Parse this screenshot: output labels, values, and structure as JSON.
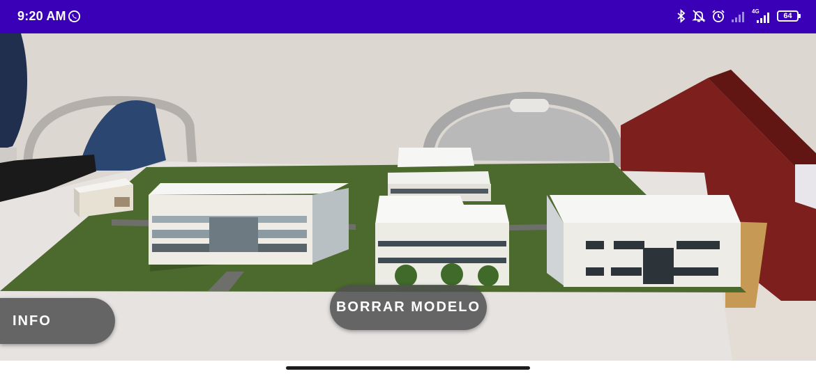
{
  "status_bar": {
    "time": "9:20 AM",
    "battery": "64",
    "network_label": "4G",
    "icons": [
      "whatsapp-icon",
      "bluetooth-icon",
      "notifications-off-icon",
      "alarm-icon",
      "signal-icon",
      "signal-4g-icon",
      "battery-icon"
    ]
  },
  "buttons": {
    "info": "INFO",
    "borrar_modelo": "BORRAR MODELO"
  },
  "colors": {
    "status_bar": "#3a00b8",
    "button_bg": "#505050",
    "model_ground": "#4c6a2e"
  }
}
